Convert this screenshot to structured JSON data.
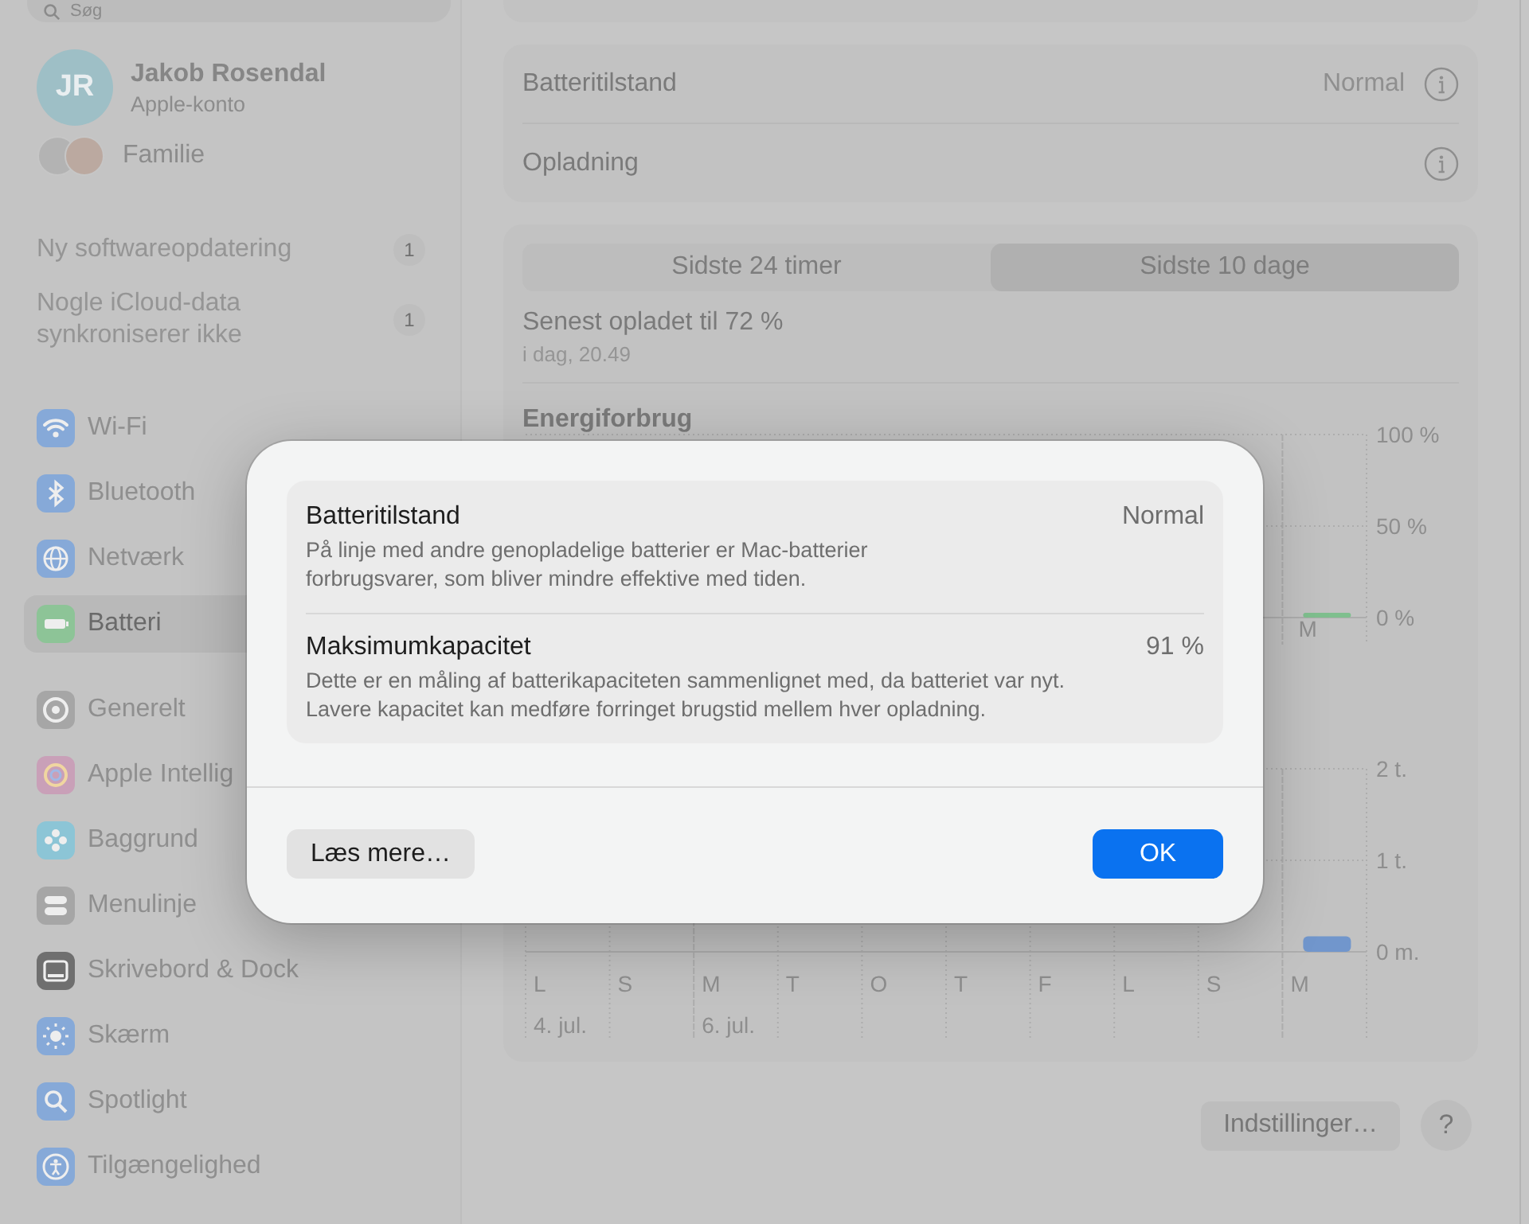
{
  "sidebar": {
    "search": {
      "placeholder": "Søg"
    },
    "account": {
      "initials": "JR",
      "name": "Jakob Rosendal",
      "subtitle": "Apple-konto"
    },
    "family": {
      "label": "Familie"
    },
    "notices": [
      {
        "text": "Ny softwareopdatering",
        "badge": "1"
      },
      {
        "text": "Nogle iCloud-data synkroniserer ikke",
        "badge": "1"
      }
    ],
    "groups": [
      [
        {
          "label": "Wi-Fi",
          "selected": false
        },
        {
          "label": "Bluetooth",
          "selected": false
        },
        {
          "label": "Netværk",
          "selected": false
        },
        {
          "label": "Batteri",
          "selected": true
        }
      ],
      [
        {
          "label": "Generelt",
          "selected": false
        },
        {
          "label": "Apple Intellig",
          "selected": false
        },
        {
          "label": "Baggrund",
          "selected": false
        },
        {
          "label": "Menulinje",
          "selected": false
        },
        {
          "label": "Skrivebord & Dock",
          "selected": false
        },
        {
          "label": "Skærm",
          "selected": false
        },
        {
          "label": "Spotlight",
          "selected": false
        },
        {
          "label": "Tilgængelighed",
          "selected": false
        }
      ]
    ]
  },
  "main": {
    "status_rows": [
      {
        "label": "Batteritilstand",
        "value": "Normal"
      },
      {
        "label": "Opladning"
      }
    ],
    "segments": [
      {
        "label": "Sidste 24 timer",
        "selected": false
      },
      {
        "label": "Sidste 10 dage",
        "selected": true
      }
    ],
    "last_charge": {
      "title": "Senest opladet til 72 %",
      "time": "i dag, 20.49"
    },
    "energy": {
      "title": "Energiforbrug",
      "chart_data": {
        "type": "bar",
        "categories": [
          "M"
        ],
        "series": [
          {
            "color": "#7fbf8e",
            "values": [
              2
            ]
          }
        ],
        "ylim": [
          0,
          100
        ],
        "yticks": [
          {
            "value": 100,
            "label": "100 %"
          },
          {
            "value": 50,
            "label": "50 %"
          },
          {
            "value": 0,
            "label": "0 %"
          }
        ]
      }
    },
    "screen_time": {
      "chart_data": {
        "type": "bar",
        "categories": [
          "L",
          "S",
          "M",
          "T",
          "O",
          "T",
          "F",
          "L",
          "S",
          "M"
        ],
        "series": [
          {
            "color": "#7196cc",
            "values": [
              0,
              0,
              0,
              0,
              0,
              0,
              0,
              0,
              0,
              0.17
            ]
          }
        ],
        "ylim": [
          0,
          2
        ],
        "yticks": [
          {
            "value": 2,
            "label": "2 t."
          },
          {
            "value": 1,
            "label": "1 t."
          },
          {
            "value": 0,
            "label": "0 m."
          }
        ]
      },
      "dates": [
        "4. jul.",
        "6. jul."
      ]
    },
    "buttons": {
      "settings": "Indstillinger…",
      "help": "?"
    }
  },
  "dialog": {
    "items": [
      {
        "title": "Batteritilstand",
        "value": "Normal",
        "description": "På linje med andre genopladelige batterier er Mac-batterier forbrugsvarer, som bliver mindre effektive med tiden."
      },
      {
        "title": "Maksimumkapacitet",
        "value": "91 %",
        "description": "Dette er en måling af batterikapaciteten sammenlignet med, da batteriet var nyt. Lavere kapacitet kan medføre forringet brugstid mellem hver opladning."
      }
    ],
    "buttons": [
      {
        "label": "Læs mere…",
        "kind": "secondary"
      },
      {
        "label": "OK",
        "kind": "default"
      }
    ]
  }
}
